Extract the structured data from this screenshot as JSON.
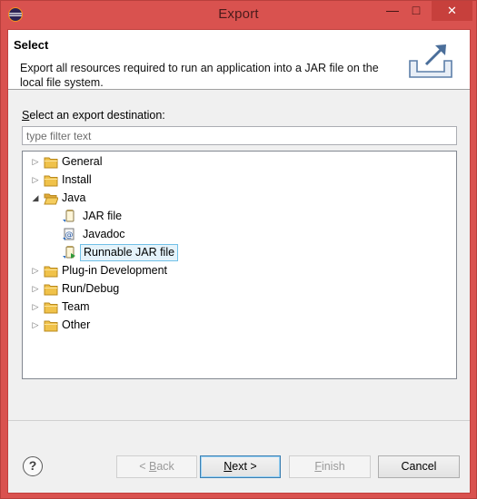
{
  "window": {
    "title": "Export",
    "minimize_glyph": "—",
    "maximize_glyph": "□",
    "close_glyph": "✕"
  },
  "header": {
    "title": "Select",
    "description": "Export all resources required to run an application into a JAR file on the local file system."
  },
  "destination": {
    "label_prefix": "S",
    "label_rest": "elect an export destination:",
    "filter_placeholder": "type filter text"
  },
  "tree": {
    "folders": [
      {
        "label": "General",
        "expanded": false
      },
      {
        "label": "Install",
        "expanded": false
      },
      {
        "label": "Java",
        "expanded": true
      },
      {
        "label": "Plug-in Development",
        "expanded": false
      },
      {
        "label": "Run/Debug",
        "expanded": false
      },
      {
        "label": "Team",
        "expanded": false
      },
      {
        "label": "Other",
        "expanded": false
      }
    ],
    "java_children": [
      {
        "label": "JAR file",
        "icon": "jar-file-icon"
      },
      {
        "label": "Javadoc",
        "icon": "javadoc-icon"
      },
      {
        "label": "Runnable JAR file",
        "icon": "runnable-jar-icon",
        "selected": true
      }
    ],
    "collapsed_arrow": "▷",
    "expanded_arrow": "◢"
  },
  "buttons": {
    "help_glyph": "?",
    "back_glyph": "< ",
    "back_key": "B",
    "back_rest": "ack",
    "next_key": "N",
    "next_rest": "ext >",
    "finish_key": "F",
    "finish_rest": "inish",
    "cancel": "Cancel"
  },
  "colors": {
    "title_bar": "#d9524f",
    "close_button": "#c7403c",
    "folder": "#f0c24a",
    "selection": "#e5f3fb"
  }
}
